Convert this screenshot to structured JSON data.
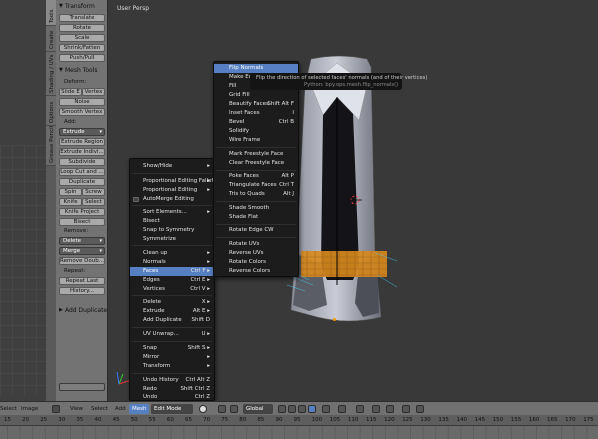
{
  "viewport": {
    "title": "User Persp"
  },
  "vtabs": [
    "Tools",
    "Create",
    "Shading / UVs",
    "Options",
    "Grease Pencil"
  ],
  "toolshelf": {
    "transform_title": "Transform",
    "transform_buttons": [
      "Translate",
      "Rotate",
      "Scale",
      "Shrink/Fatten",
      "Push/Pull"
    ],
    "mesh_tools_title": "Mesh Tools",
    "deform_label": "Deform:",
    "slide_edge": "Slide E",
    "vertex": "Vertex",
    "noise": "Noise",
    "smooth_vertex": "Smooth Vertex",
    "add_label": "Add:",
    "extrude": "Extrude",
    "extrude_region": "Extrude Region",
    "extrude_individual": "Extrude Indivi...",
    "subdivide": "Subdivide",
    "loop_cut": "Loop Cut and ...",
    "duplicate": "Duplicate",
    "spin": "Spin",
    "screw": "Screw",
    "knife": "Knife",
    "select": "Select",
    "knife_project": "Knife Project",
    "bisect": "Bisect",
    "remove_label": "Remove:",
    "delete": "Delete",
    "merge": "Merge",
    "remove_doubles": "Remove Doub...",
    "repeat_label": "Repeat:",
    "repeat_last": "Repeat Last",
    "history": "History...",
    "add_duplicate": "Add Duplicate"
  },
  "mesh_menu": {
    "items": [
      {
        "label": "Show/Hide",
        "key": "▸"
      },
      {
        "label": "Proportional Editing Falloff",
        "key": "▸"
      },
      {
        "label": "Proportional Editing",
        "key": "▸"
      },
      {
        "label": "AutoMerge Editing",
        "key": ""
      },
      {
        "label": "Sort Elements...",
        "key": "▸"
      },
      {
        "label": "Bisect",
        "key": ""
      },
      {
        "label": "Snap to Symmetry",
        "key": ""
      },
      {
        "label": "Symmetrize",
        "key": ""
      },
      {
        "label": "Clean up",
        "key": "▸"
      },
      {
        "label": "Normals",
        "key": "▸"
      },
      {
        "label": "Faces",
        "key": "Ctrl F ▸"
      },
      {
        "label": "Edges",
        "key": "Ctrl E ▸"
      },
      {
        "label": "Vertices",
        "key": "Ctrl V ▸"
      },
      {
        "label": "Delete",
        "key": "X ▸"
      },
      {
        "label": "Extrude",
        "key": "Alt E ▸"
      },
      {
        "label": "Add Duplicate",
        "key": "Shift D"
      },
      {
        "label": "UV Unwrap...",
        "key": "U ▸"
      },
      {
        "label": "Snap",
        "key": "Shift S ▸"
      },
      {
        "label": "Mirror",
        "key": "▸"
      },
      {
        "label": "Transform",
        "key": "▸"
      },
      {
        "label": "Undo History",
        "key": "Ctrl Alt Z"
      },
      {
        "label": "Redo",
        "key": "Shift Ctrl Z"
      },
      {
        "label": "Undo",
        "key": "Ctrl Z"
      }
    ]
  },
  "faces_menu": {
    "items": [
      {
        "label": "Flip Normals",
        "key": ""
      },
      {
        "label": "Make Edge/Face",
        "key": ""
      },
      {
        "label": "Fill",
        "key": ""
      },
      {
        "label": "Grid Fill",
        "key": ""
      },
      {
        "label": "Beautify Faces",
        "key": "Shift Alt F"
      },
      {
        "label": "Inset Faces",
        "key": "I"
      },
      {
        "label": "Bevel",
        "key": "Ctrl B"
      },
      {
        "label": "Solidify",
        "key": ""
      },
      {
        "label": "Wire Frame",
        "key": ""
      },
      {
        "label": "Mark Freestyle Face",
        "key": ""
      },
      {
        "label": "Clear Freestyle Face",
        "key": ""
      },
      {
        "label": "Poke Faces",
        "key": "Alt P"
      },
      {
        "label": "Triangulate Faces",
        "key": "Ctrl T"
      },
      {
        "label": "Tris to Quads",
        "key": "Alt J"
      },
      {
        "label": "Shade Smooth",
        "key": ""
      },
      {
        "label": "Shade Flat",
        "key": ""
      },
      {
        "label": "Rotate Edge CW",
        "key": ""
      },
      {
        "label": "Rotate UVs",
        "key": ""
      },
      {
        "label": "Reverse UVs",
        "key": ""
      },
      {
        "label": "Rotate Colors",
        "key": ""
      },
      {
        "label": "Reverse Colors",
        "key": ""
      }
    ]
  },
  "tooltip": {
    "line1": "Flip the direction of selected faces' normals (and of their vertices)",
    "line2": "Python: bpy.ops.mesh.flip_normals()"
  },
  "header": {
    "select": "Select",
    "image": "Image",
    "view": "View",
    "select2": "Select",
    "add": "Add",
    "mesh": "Mesh",
    "mode": "Edit Mode",
    "pivot": "Global"
  },
  "ruler": [
    "15",
    "20",
    "25",
    "30",
    "35",
    "40",
    "45",
    "50",
    "55",
    "60",
    "65",
    "70",
    "75",
    "80",
    "85",
    "90",
    "95",
    "100",
    "105",
    "110",
    "115",
    "120",
    "125",
    "130",
    "135",
    "140",
    "145",
    "150",
    "155",
    "160",
    "165",
    "170",
    "175"
  ],
  "colors": {
    "highlight": "#5680c2",
    "menu_bg": "#1c1c1c",
    "viewport_bg": "#393939"
  }
}
